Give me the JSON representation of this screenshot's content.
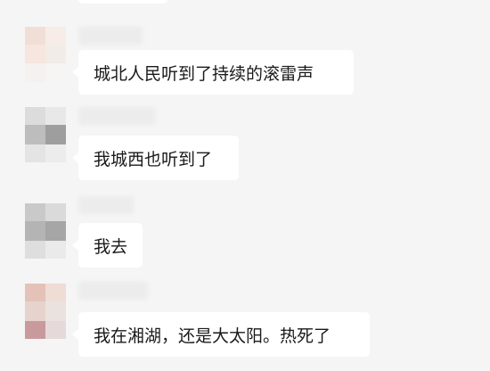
{
  "messages": [
    {
      "text": "城北人民听到了持续的滚雷声"
    },
    {
      "text": "我城西也听到了"
    },
    {
      "text": "我去"
    },
    {
      "text": "我在湘湖，还是大太阳。热死了"
    }
  ]
}
